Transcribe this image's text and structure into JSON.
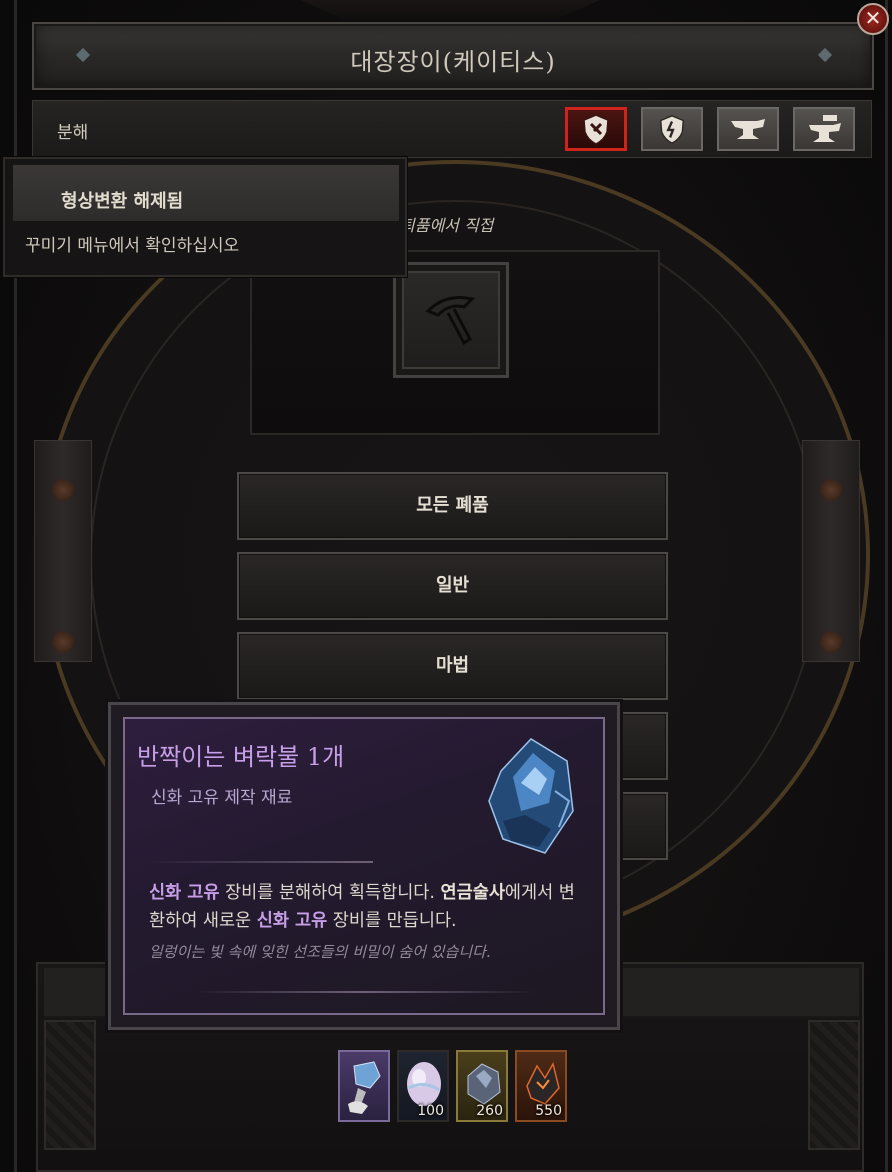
{
  "window": {
    "title": "대장장이(케이티스)",
    "close_label": "✕"
  },
  "tab_bar": {
    "label": "분해",
    "tabs": [
      {
        "name": "salvage",
        "active": true
      },
      {
        "name": "upgrade",
        "active": false
      },
      {
        "name": "anvil",
        "active": false
      },
      {
        "name": "imprint",
        "active": false
      }
    ]
  },
  "info_text": "퇴품에서 직접",
  "unlock_tooltip": {
    "title": "형상변환 해제됨",
    "body": "꾸미기 메뉴에서 확인하십시오"
  },
  "salvage_buttons": [
    {
      "label": "모든 폐품"
    },
    {
      "label": "일반"
    },
    {
      "label": "마법"
    }
  ],
  "item_tooltip": {
    "name": "반짝이는 벼락불 1개",
    "subtitle": "신화 고유 제작 재료",
    "desc_part1_hl": "신화 고유",
    "desc_part2": " 장비를 분해하여 획득합니다. ",
    "desc_part3_bold": "연금술사",
    "desc_part4": "에게서 변환하여 새로운 ",
    "desc_part5_hl": "신화 고유",
    "desc_part6": " 장비를 만듭니다.",
    "flavor": "일렁이는 빛 속에 잊힌 선조들의 비밀이 숨어 있습니다.",
    "name_color": "#c79ee8"
  },
  "materials": [
    {
      "name": "shimmering-hammer-icon",
      "count": ""
    },
    {
      "name": "pearl-egg-icon",
      "count": "100"
    },
    {
      "name": "crystal-ore-icon",
      "count": "260"
    },
    {
      "name": "fire-crystal-icon",
      "count": "550"
    }
  ],
  "colors": {
    "accent_red": "#d0231b",
    "mythic_purple": "#c79ee8"
  }
}
